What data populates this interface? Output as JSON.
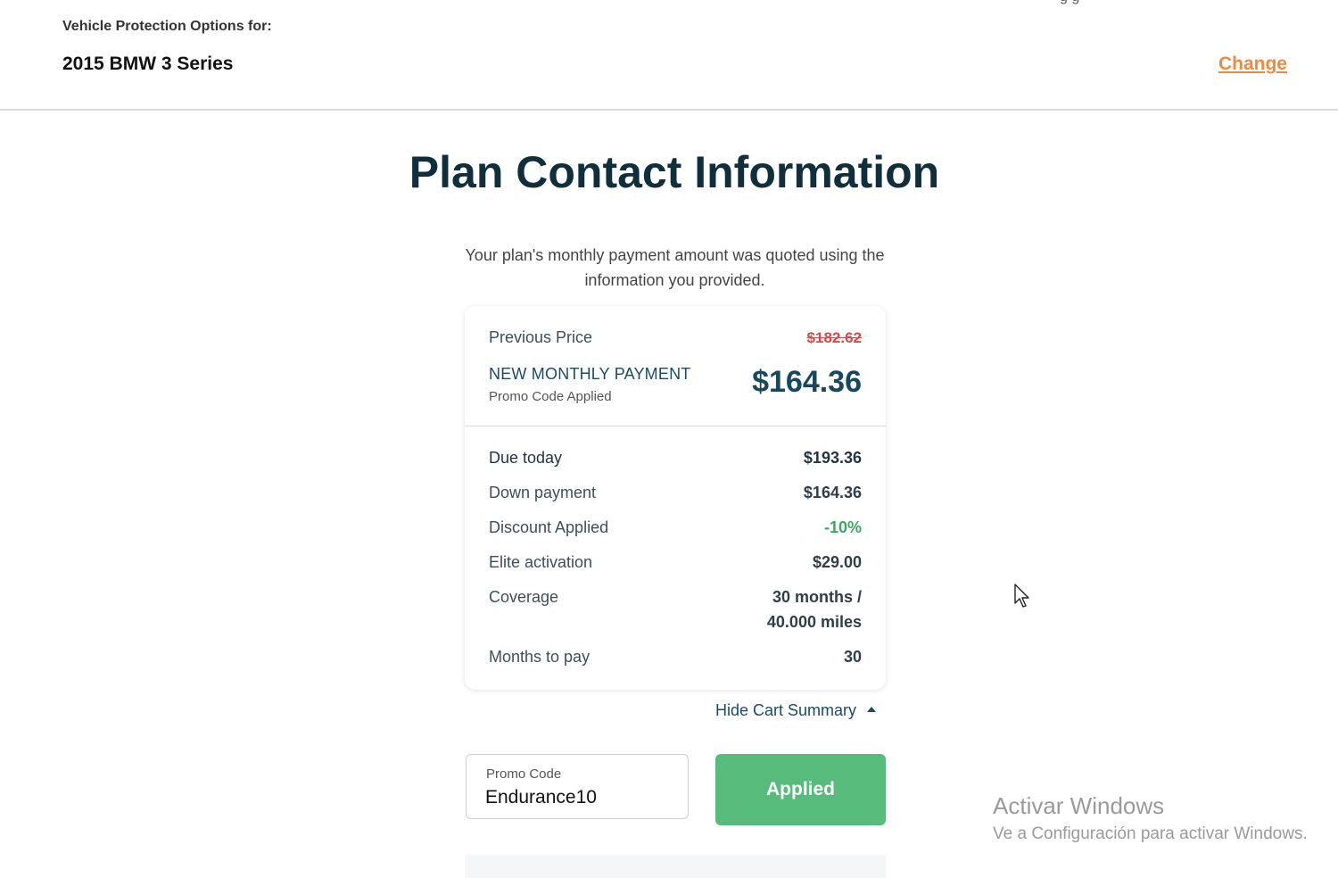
{
  "header": {
    "label": "Vehicle Protection Options for:",
    "vehicle": "2015 BMW 3 Series",
    "change_link": "Change",
    "cut_text": "g g"
  },
  "main": {
    "title": "Plan Contact Information",
    "subtitle": "Your plan's monthly payment amount was quoted using the information you provided."
  },
  "cart": {
    "previous_price_label": "Previous Price",
    "previous_price_value": "$182.62",
    "new_payment_label": "NEW MONTHLY PAYMENT",
    "promo_applied_label": "Promo Code Applied",
    "new_payment_value": "$164.36",
    "rows": [
      {
        "label": "Due today",
        "value": "$193.36"
      },
      {
        "label": "Down payment",
        "value": "$164.36"
      },
      {
        "label": "Discount Applied",
        "value": "-10%"
      },
      {
        "label": "Elite activation",
        "value": "$29.00"
      },
      {
        "label": "Coverage",
        "value_line1": "30 months /",
        "value_line2": "40.000 miles"
      },
      {
        "label": "Months to pay",
        "value": "30"
      }
    ],
    "hide_summary_label": "Hide Cart Summary"
  },
  "promo": {
    "caption": "Promo Code",
    "value": "Endurance10",
    "button_label": "Applied"
  },
  "watermark": {
    "title": "Activar Windows",
    "subtitle": "Ve a Configuración para activar Windows."
  },
  "colors": {
    "accent_orange": "#f08a3c",
    "primary_navy": "#17485e",
    "success_green": "#57bb7b",
    "strike_red": "#d44a4a"
  }
}
